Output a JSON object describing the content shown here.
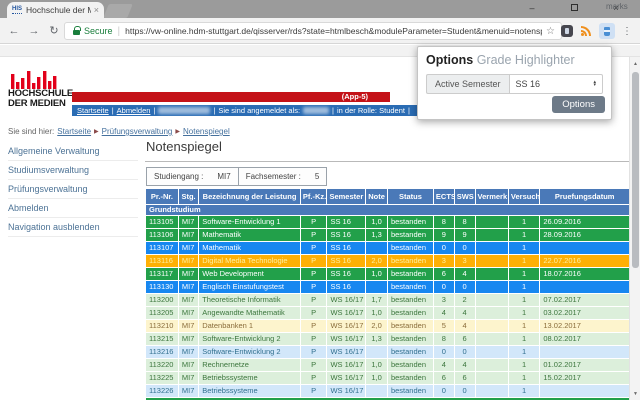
{
  "browser": {
    "tab": {
      "title": "Hochschule der Medien",
      "favicon_text": "HIS"
    },
    "address": {
      "secure_label": "Secure",
      "url": "https://vw-online.hdm-stuttgart.de/qisserver/rds?state=htmlbesch&moduleParameter=Student&menuid=notenspiegel&breadcrumb=notens..."
    },
    "bookmarks_right_label": "marks"
  },
  "icons": {
    "back": "←",
    "forward": "→",
    "reload": "↻",
    "bookmark_star": "☆",
    "menu": "⋮",
    "tab_close": "×",
    "minimize": "–",
    "close": "×",
    "scroll_up": "▲",
    "scroll_down": "▼",
    "select_up": "▴",
    "select_down": "▾",
    "breadcrumb_sep": "▶",
    "addr_sep": "|"
  },
  "popup": {
    "title": "Options",
    "app_name": "Grade Highlighter",
    "semester_label": "Active Semester",
    "semester_value": "SS 16",
    "options_button": "Options"
  },
  "site": {
    "logo": {
      "line1": "HOCHSCHULE",
      "line2": "DER MEDIEN"
    },
    "banner": {
      "app_label": "(App-5)"
    },
    "nav": {
      "link1": "Startseite",
      "sep": "|",
      "link2": "Abmelden",
      "signed_in_label": "Sie sind angemeldet als:",
      "role_label": "in der Rolle: Student"
    },
    "breadcrumb": {
      "prefix": "Sie sind hier:",
      "items": [
        "Startseite",
        "Prüfungsverwaltung",
        "Notenspiegel"
      ]
    },
    "menu": [
      "Allgemeine Verwaltung",
      "Studiumsverwaltung",
      "Prüfungsverwaltung",
      "Abmelden",
      "Navigation ausblenden"
    ],
    "page_title": "Notenspiegel",
    "filter": {
      "label1": "Studiengang :",
      "value1": "MI7",
      "label2": "Fachsemester :",
      "value2": "5"
    },
    "table": {
      "columns": [
        "Pr.-Nr.",
        "Stg.",
        "Bezeichnung der Leistung",
        "Pf.-Kz.",
        "Semester",
        "Note",
        "Status",
        "ECTS",
        "SWS",
        "Vermerk",
        "Versuch",
        "Pruefungsdatum"
      ],
      "section": "Grundstudium",
      "rows": [
        {
          "nr": "113105",
          "stg": "MI7",
          "name": "Software-Entwicklung 1",
          "pfkz": "P",
          "semester": "SS 16",
          "note": "1,0",
          "status": "bestanden",
          "ects": "8",
          "sws": "8",
          "vermerk": "",
          "versuch": "1",
          "datum": "26.09.2016",
          "highlight": "green"
        },
        {
          "nr": "113106",
          "stg": "MI7",
          "name": "Mathematik",
          "pfkz": "P",
          "semester": "SS 16",
          "note": "1,3",
          "status": "bestanden",
          "ects": "9",
          "sws": "9",
          "vermerk": "",
          "versuch": "1",
          "datum": "28.09.2016",
          "highlight": "green"
        },
        {
          "nr": "113107",
          "stg": "MI7",
          "name": "Mathematik",
          "pfkz": "P",
          "semester": "SS 16",
          "note": "",
          "status": "bestanden",
          "ects": "0",
          "sws": "0",
          "vermerk": "",
          "versuch": "1",
          "datum": "",
          "highlight": "blue"
        },
        {
          "nr": "113116",
          "stg": "MI7",
          "name": "Digital Media Technologie",
          "pfkz": "P",
          "semester": "SS 16",
          "note": "2,0",
          "status": "bestanden",
          "ects": "3",
          "sws": "3",
          "vermerk": "",
          "versuch": "1",
          "datum": "22.07.2016",
          "highlight": "orange"
        },
        {
          "nr": "113117",
          "stg": "MI7",
          "name": "Web Development",
          "pfkz": "P",
          "semester": "SS 16",
          "note": "1,0",
          "status": "bestanden",
          "ects": "6",
          "sws": "4",
          "vermerk": "",
          "versuch": "1",
          "datum": "18.07.2016",
          "highlight": "green"
        },
        {
          "nr": "113130",
          "stg": "MI7",
          "name": "Englisch Einstufungstest",
          "pfkz": "P",
          "semester": "SS 16",
          "note": "",
          "status": "bestanden",
          "ects": "0",
          "sws": "0",
          "vermerk": "",
          "versuch": "1",
          "datum": "",
          "highlight": "blue"
        },
        {
          "nr": "113200",
          "stg": "MI7",
          "name": "Theoretische Informatik",
          "pfkz": "P",
          "semester": "WS 16/17",
          "note": "1,7",
          "status": "bestanden",
          "ects": "3",
          "sws": "2",
          "vermerk": "",
          "versuch": "1",
          "datum": "07.02.2017",
          "highlight": "light-green"
        },
        {
          "nr": "113205",
          "stg": "MI7",
          "name": "Angewandte Mathematik",
          "pfkz": "P",
          "semester": "WS 16/17",
          "note": "1,0",
          "status": "bestanden",
          "ects": "4",
          "sws": "4",
          "vermerk": "",
          "versuch": "1",
          "datum": "03.02.2017",
          "highlight": "light-green"
        },
        {
          "nr": "113210",
          "stg": "MI7",
          "name": "Datenbanken 1",
          "pfkz": "P",
          "semester": "WS 16/17",
          "note": "2,0",
          "status": "bestanden",
          "ects": "5",
          "sws": "4",
          "vermerk": "",
          "versuch": "1",
          "datum": "13.02.2017",
          "highlight": "light-yellow"
        },
        {
          "nr": "113215",
          "stg": "MI7",
          "name": "Software-Entwicklung 2",
          "pfkz": "P",
          "semester": "WS 16/17",
          "note": "1,3",
          "status": "bestanden",
          "ects": "8",
          "sws": "6",
          "vermerk": "",
          "versuch": "1",
          "datum": "08.02.2017",
          "highlight": "light-green"
        },
        {
          "nr": "113216",
          "stg": "MI7",
          "name": "Software-Entwicklung 2",
          "pfkz": "P",
          "semester": "WS 16/17",
          "note": "",
          "status": "bestanden",
          "ects": "0",
          "sws": "0",
          "vermerk": "",
          "versuch": "1",
          "datum": "",
          "highlight": "light-blue"
        },
        {
          "nr": "113220",
          "stg": "MI7",
          "name": "Rechnernetze",
          "pfkz": "P",
          "semester": "WS 16/17",
          "note": "1,0",
          "status": "bestanden",
          "ects": "4",
          "sws": "4",
          "vermerk": "",
          "versuch": "1",
          "datum": "01.02.2017",
          "highlight": "light-green"
        },
        {
          "nr": "113225",
          "stg": "MI7",
          "name": "Betriebssysteme",
          "pfkz": "P",
          "semester": "WS 16/17",
          "note": "1,0",
          "status": "bestanden",
          "ects": "6",
          "sws": "6",
          "vermerk": "",
          "versuch": "1",
          "datum": "15.02.2017",
          "highlight": "light-green"
        },
        {
          "nr": "113226",
          "stg": "MI7",
          "name": "Betriebssysteme",
          "pfkz": "P",
          "semester": "WS 16/17",
          "note": "",
          "status": "bestanden",
          "ects": "0",
          "sws": "0",
          "vermerk": "",
          "versuch": "1",
          "datum": "",
          "highlight": "light-blue"
        }
      ]
    }
  },
  "colors": {
    "green": "#22a04a",
    "green_text": "#ffffff",
    "blue": "#1787f0",
    "blue_text": "#ffffff",
    "orange": "#ffb005",
    "orange_text": "#fff0a0",
    "light-green": "#dcefdb",
    "light-green_text": "#3c763d",
    "light-blue": "#d2e7fa",
    "light-blue_text": "#31708f",
    "light-yellow": "#fdf4cd",
    "light-yellow_text": "#8a6d3b",
    "header_blue": "#4a79b8",
    "banner_red": "#c41218",
    "banner_blue": "#2a6cb4",
    "brand_red": "#e2001a",
    "secure_green": "#1a7e3c",
    "popup_button_gray": "#6d7a88"
  }
}
